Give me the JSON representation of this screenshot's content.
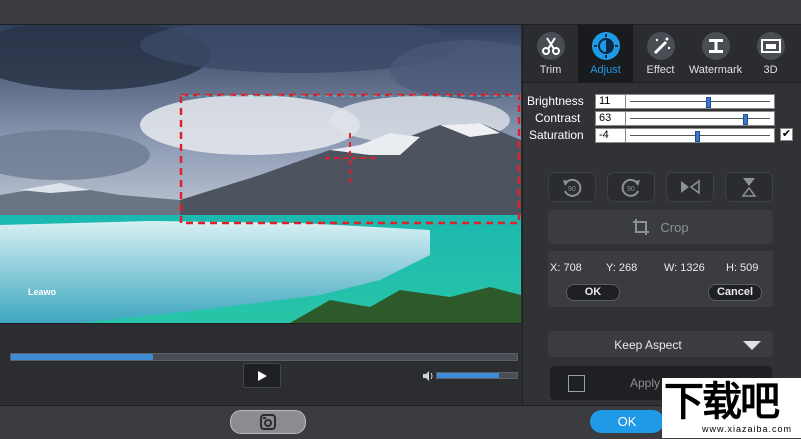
{
  "preview": {
    "image_description_icon": "glacier-landscape",
    "logo_text": "Leawo"
  },
  "playback": {
    "progress": 0.28,
    "volume": 0.78
  },
  "tabs": [
    {
      "label": "Trim",
      "icon": "scissors-icon",
      "active": false
    },
    {
      "label": "Adjust",
      "icon": "brightness-icon",
      "active": true
    },
    {
      "label": "Effect",
      "icon": "magic-wand-icon",
      "active": false
    },
    {
      "label": "Watermark",
      "icon": "watermark-icon",
      "active": false
    },
    {
      "label": "3D",
      "icon": "3d-icon",
      "active": false
    }
  ],
  "adjust": {
    "brightness": {
      "label": "Brightness",
      "value": "11",
      "level": 0.56
    },
    "contrast": {
      "label": "Contrast",
      "value": "63",
      "level": 0.82
    },
    "saturation": {
      "label": "Saturation",
      "value": "-4",
      "level": 0.48
    },
    "checkbox": "✔"
  },
  "crop": {
    "button_label": "Crop",
    "x_label": "X: 708",
    "y_label": "Y: 268",
    "w_label": "W: 1326",
    "h_label": "H: 509",
    "ok_label": "OK",
    "cancel_label": "Cancel"
  },
  "aspect": {
    "label": "Keep Aspect"
  },
  "apply_all": {
    "label": "Apply to all"
  },
  "footer": {
    "ok_label": "OK"
  },
  "watermark": {
    "big": "下载吧",
    "small": "www.xiazaiba.com"
  },
  "colors": {
    "accent": "#1e9ae6",
    "crop_border": "#e0202a",
    "progress": "#3e8bd6"
  }
}
